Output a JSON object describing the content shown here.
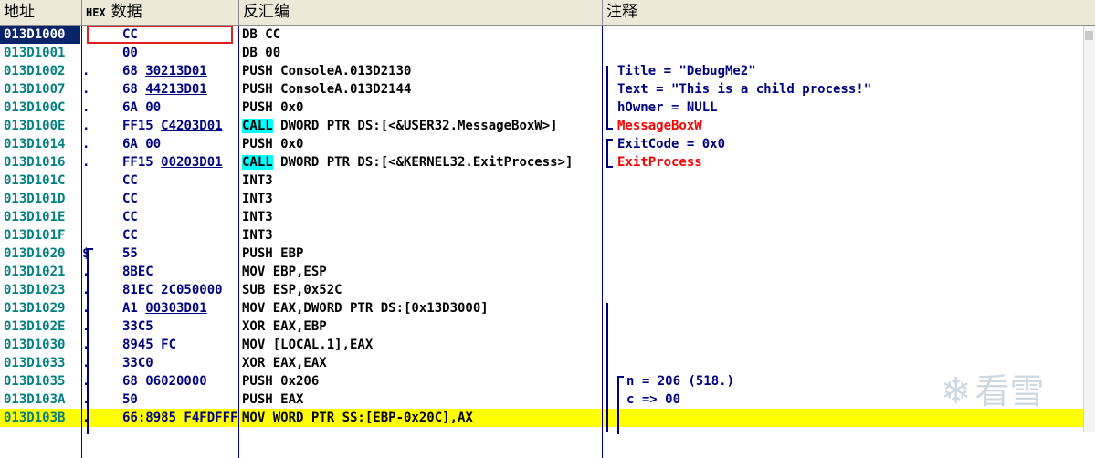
{
  "header": {
    "address": "地址",
    "hex_label": "HEX",
    "data": "数据",
    "disassembly": "反汇编",
    "comment": "注释"
  },
  "rows": [
    {
      "addr": "013D1000",
      "mark": "",
      "hex_pre": "CC",
      "hex_u": "",
      "dis_pre": "",
      "dis_call": "",
      "dis_rest": "DB CC",
      "cmt": "",
      "cmt_red": false
    },
    {
      "addr": "013D1001",
      "mark": "",
      "hex_pre": "00",
      "hex_u": "",
      "dis_pre": "",
      "dis_call": "",
      "dis_rest": "DB 00",
      "cmt": "",
      "cmt_red": false
    },
    {
      "addr": "013D1002",
      "mark": ".",
      "hex_pre": "68 ",
      "hex_u": "30213D01",
      "dis_pre": "",
      "dis_call": "",
      "dis_rest": "PUSH ConsoleA.013D2130",
      "cmt": "Title = \"DebugMe2\"",
      "cmt_red": false
    },
    {
      "addr": "013D1007",
      "mark": ".",
      "hex_pre": "68 ",
      "hex_u": "44213D01",
      "dis_pre": "",
      "dis_call": "",
      "dis_rest": "PUSH ConsoleA.013D2144",
      "cmt": "Text = \"This is a child process!\"",
      "cmt_red": false
    },
    {
      "addr": "013D100C",
      "mark": ".",
      "hex_pre": "6A 00",
      "hex_u": "",
      "dis_pre": "",
      "dis_call": "",
      "dis_rest": "PUSH 0x0",
      "cmt": "hOwner = NULL",
      "cmt_red": false
    },
    {
      "addr": "013D100E",
      "mark": ".",
      "hex_pre": "FF15 ",
      "hex_u": "C4203D01",
      "dis_pre": "",
      "dis_call": "CALL",
      "dis_rest": " DWORD PTR DS:[<&USER32.MessageBoxW>]",
      "cmt": "MessageBoxW",
      "cmt_red": true
    },
    {
      "addr": "013D1014",
      "mark": ".",
      "hex_pre": "6A 00",
      "hex_u": "",
      "dis_pre": "",
      "dis_call": "",
      "dis_rest": "PUSH 0x0",
      "cmt": "ExitCode = 0x0",
      "cmt_red": false
    },
    {
      "addr": "013D1016",
      "mark": ".",
      "hex_pre": "FF15 ",
      "hex_u": "00203D01",
      "dis_pre": "",
      "dis_call": "CALL",
      "dis_rest": " DWORD PTR DS:[<&KERNEL32.ExitProcess>]",
      "cmt": "ExitProcess",
      "cmt_red": true
    },
    {
      "addr": "013D101C",
      "mark": "",
      "hex_pre": "CC",
      "hex_u": "",
      "dis_pre": "",
      "dis_call": "",
      "dis_rest": "INT3",
      "cmt": "",
      "cmt_red": false
    },
    {
      "addr": "013D101D",
      "mark": "",
      "hex_pre": "CC",
      "hex_u": "",
      "dis_pre": "",
      "dis_call": "",
      "dis_rest": "INT3",
      "cmt": "",
      "cmt_red": false
    },
    {
      "addr": "013D101E",
      "mark": "",
      "hex_pre": "CC",
      "hex_u": "",
      "dis_pre": "",
      "dis_call": "",
      "dis_rest": "INT3",
      "cmt": "",
      "cmt_red": false
    },
    {
      "addr": "013D101F",
      "mark": "",
      "hex_pre": "CC",
      "hex_u": "",
      "dis_pre": "",
      "dis_call": "",
      "dis_rest": "INT3",
      "cmt": "",
      "cmt_red": false
    },
    {
      "addr": "013D1020",
      "mark": "$",
      "hex_pre": "55",
      "hex_u": "",
      "dis_pre": "",
      "dis_call": "",
      "dis_rest": "PUSH EBP",
      "cmt": "",
      "cmt_red": false
    },
    {
      "addr": "013D1021",
      "mark": ".",
      "hex_pre": "8BEC",
      "hex_u": "",
      "dis_pre": "",
      "dis_call": "",
      "dis_rest": "MOV EBP,ESP",
      "cmt": "",
      "cmt_red": false
    },
    {
      "addr": "013D1023",
      "mark": ".",
      "hex_pre": "81EC 2C050000",
      "hex_u": "",
      "dis_pre": "",
      "dis_call": "",
      "dis_rest": "SUB ESP,0x52C",
      "cmt": "",
      "cmt_red": false
    },
    {
      "addr": "013D1029",
      "mark": ".",
      "hex_pre": "A1 ",
      "hex_u": "00303D01",
      "dis_pre": "",
      "dis_call": "",
      "dis_rest": "MOV EAX,DWORD PTR DS:[0x13D3000]",
      "cmt": "",
      "cmt_red": false
    },
    {
      "addr": "013D102E",
      "mark": ".",
      "hex_pre": "33C5",
      "hex_u": "",
      "dis_pre": "",
      "dis_call": "",
      "dis_rest": "XOR EAX,EBP",
      "cmt": "",
      "cmt_red": false
    },
    {
      "addr": "013D1030",
      "mark": ".",
      "hex_pre": "8945 FC",
      "hex_u": "",
      "dis_pre": "",
      "dis_call": "",
      "dis_rest": "MOV [LOCAL.1],EAX",
      "cmt": "",
      "cmt_red": false
    },
    {
      "addr": "013D1033",
      "mark": ".",
      "hex_pre": "33C0",
      "hex_u": "",
      "dis_pre": "",
      "dis_call": "",
      "dis_rest": "XOR EAX,EAX",
      "cmt": "",
      "cmt_red": false
    },
    {
      "addr": "013D1035",
      "mark": ".",
      "hex_pre": "68 06020000",
      "hex_u": "",
      "dis_pre": "",
      "dis_call": "",
      "dis_rest": "PUSH 0x206",
      "cmt": "n = 206 (518.)",
      "cmt_red": false
    },
    {
      "addr": "013D103A",
      "mark": ".",
      "hex_pre": "50",
      "hex_u": "",
      "dis_pre": "",
      "dis_call": "",
      "dis_rest": "PUSH EAX",
      "cmt": "c => 00",
      "cmt_red": false
    },
    {
      "addr": "013D103B",
      "mark": ".",
      "hex_pre": "66:8985 F4FDFFFF",
      "hex_u": "",
      "dis_pre": "",
      "dis_call": "",
      "dis_rest": "MOV WORD PTR SS:[EBP-0x20C],AX",
      "cmt": "",
      "cmt_red": false
    }
  ],
  "selected_row": 0,
  "highlighted_row": 21,
  "watermark": {
    "symbol": "❄",
    "text": "看雪"
  }
}
